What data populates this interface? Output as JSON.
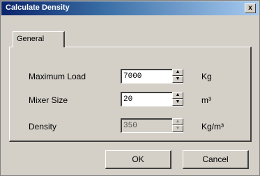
{
  "window": {
    "title": "Calculate Density",
    "close_label": "x"
  },
  "tabs": [
    {
      "label": "General",
      "selected": true
    }
  ],
  "fields": {
    "max_load": {
      "label": "Maximum Load",
      "value": "7000",
      "unit": "Kg"
    },
    "mixer_size": {
      "label": "Mixer Size",
      "value": "20",
      "unit": "m³"
    },
    "density": {
      "label": "Density",
      "value": "350",
      "unit": "Kg/m³",
      "disabled": true
    }
  },
  "buttons": {
    "ok": "OK",
    "cancel": "Cancel"
  },
  "icons": {
    "spin_up": "▲",
    "spin_down": "▼"
  },
  "colors": {
    "title_start": "#0a246a",
    "title_end": "#a6caf0",
    "face": "#d4d0c8"
  }
}
